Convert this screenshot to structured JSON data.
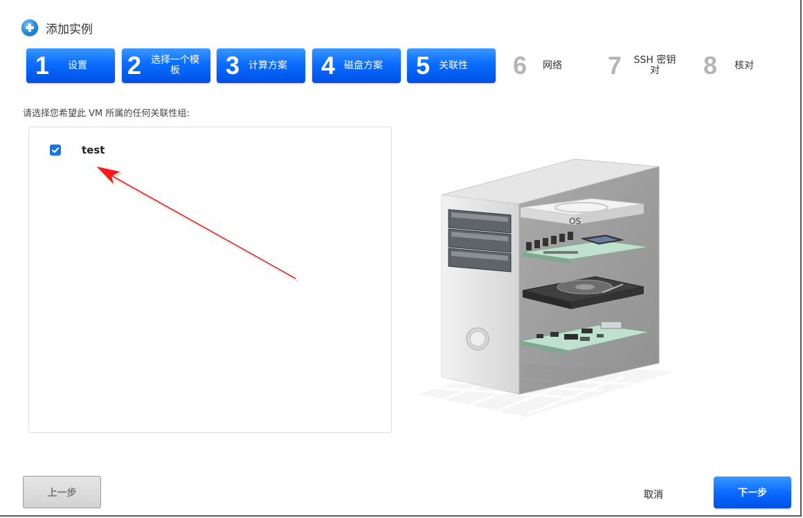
{
  "dialog": {
    "title": "添加实例"
  },
  "steps": [
    {
      "num": "1",
      "label": "设置",
      "active": true
    },
    {
      "num": "2",
      "label": "选择一个模板",
      "active": true
    },
    {
      "num": "3",
      "label": "计算方案",
      "active": true
    },
    {
      "num": "4",
      "label": "磁盘方案",
      "active": true
    },
    {
      "num": "5",
      "label": "关联性",
      "active": true
    },
    {
      "num": "6",
      "label": "网络",
      "active": false
    },
    {
      "num": "7",
      "label": "SSH 密钥对",
      "active": false
    },
    {
      "num": "8",
      "label": "核对",
      "active": false
    }
  ],
  "affinity": {
    "instruction": "请选择您希望此 VM 所属的任何关联性组:",
    "groups": [
      {
        "name": "test",
        "checked": true
      }
    ]
  },
  "illustration": {
    "disk_label": "OS"
  },
  "footer": {
    "prev_label": "上一步",
    "cancel_label": "取消",
    "next_label": "下一步"
  },
  "colors": {
    "accent": "#0a6cff",
    "annotation": "#e00000"
  },
  "icons": {
    "title": "add-circle-icon",
    "check": "checkmark-icon",
    "annotation": "red-arrow-icon"
  }
}
